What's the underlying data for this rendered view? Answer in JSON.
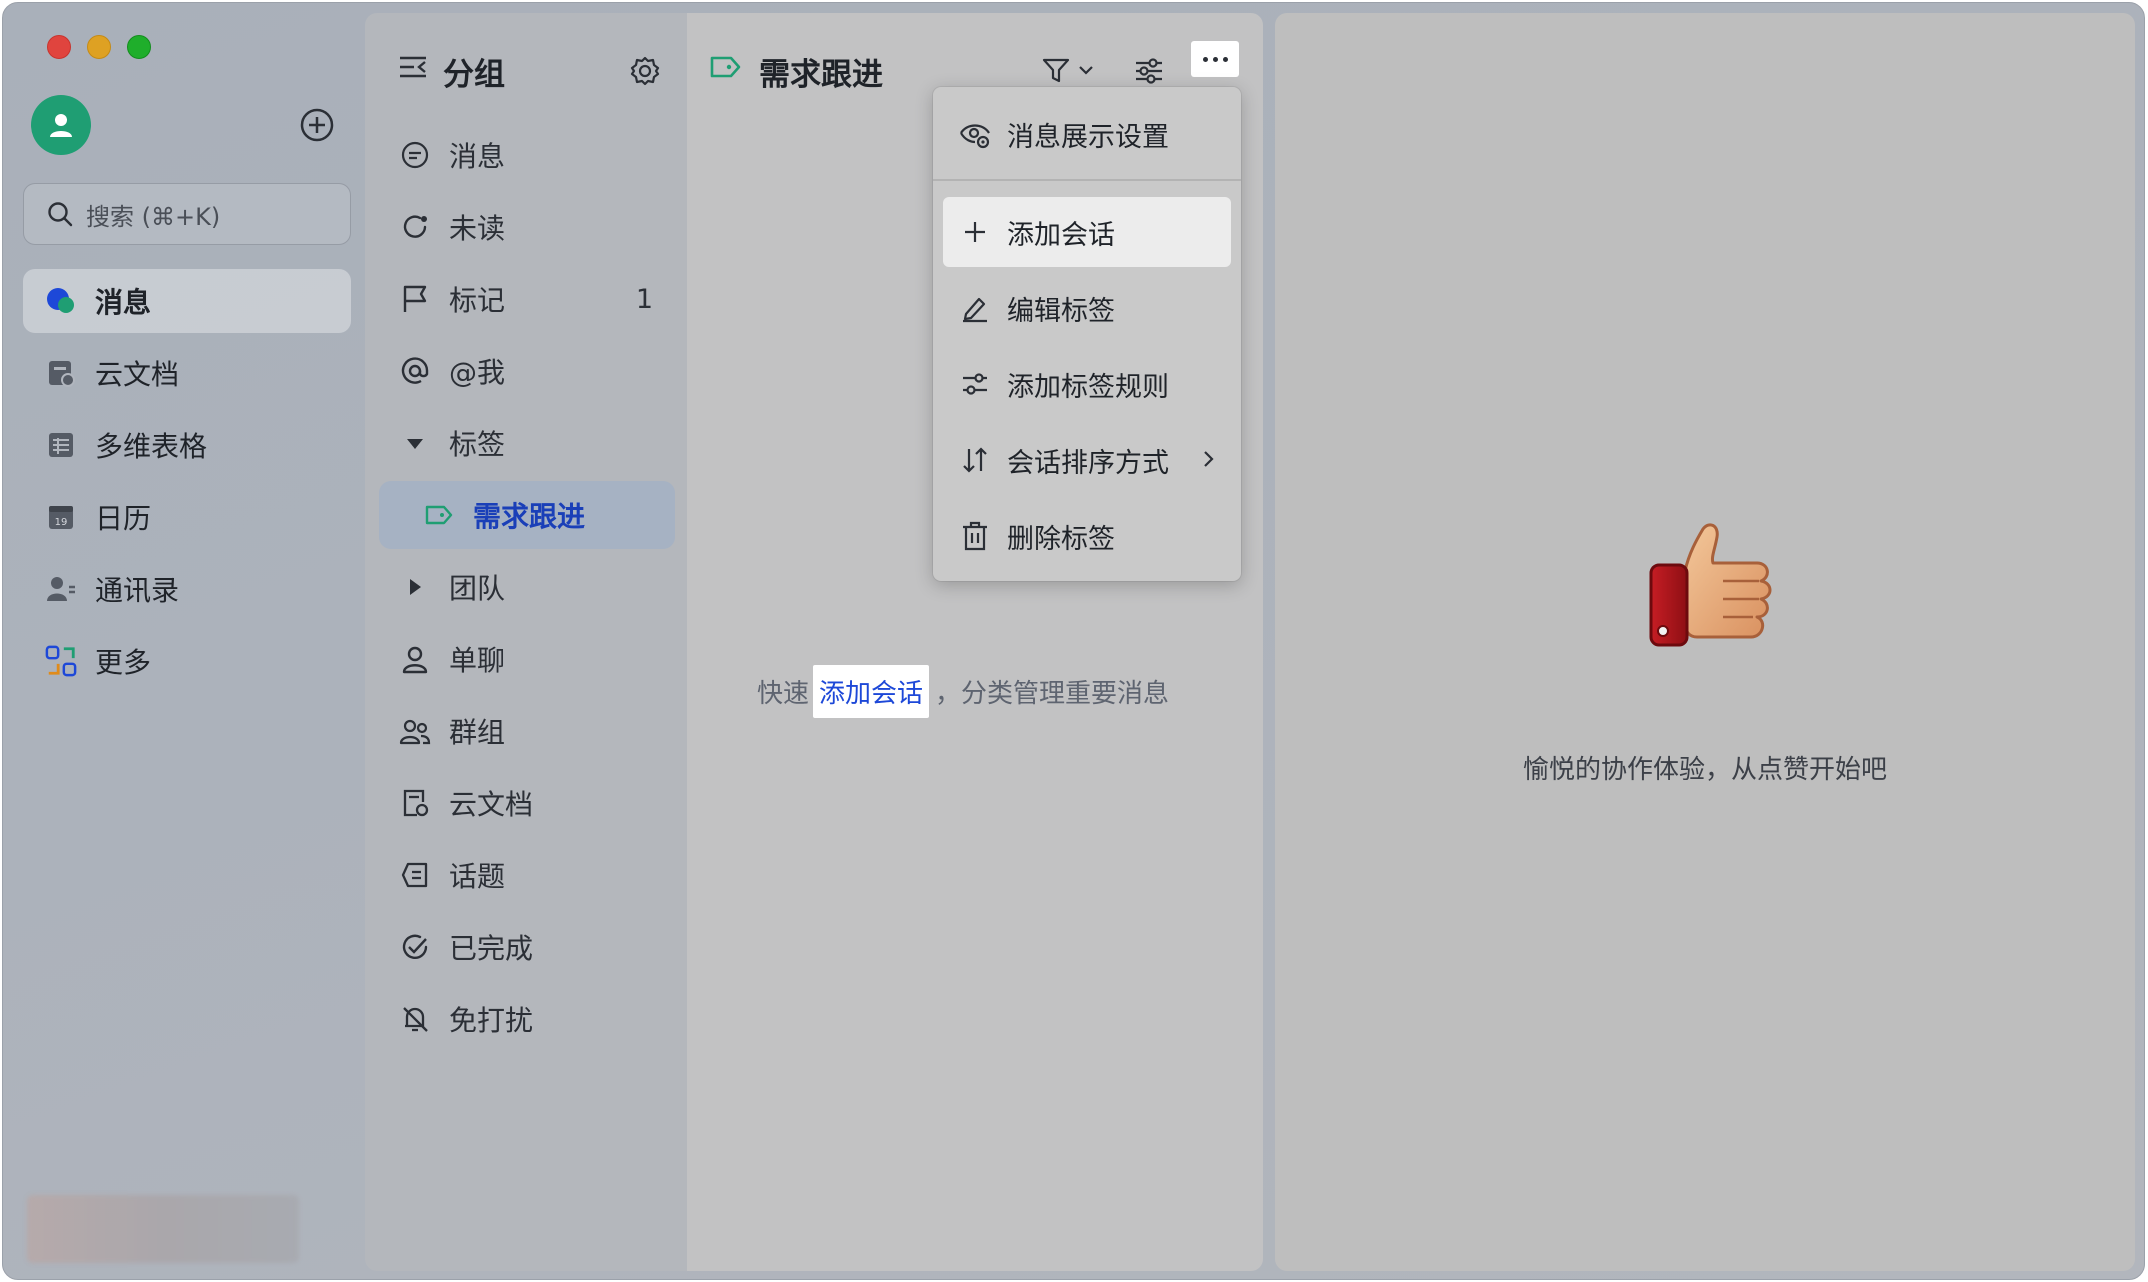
{
  "window": {
    "traffic_lights": [
      "close",
      "minimize",
      "maximize"
    ]
  },
  "sidebar": {
    "search_placeholder": "搜索 (⌘+K)",
    "items": [
      {
        "label": "消息",
        "icon": "message-bubble-icon",
        "active": true
      },
      {
        "label": "云文档",
        "icon": "cloud-doc-icon"
      },
      {
        "label": "多维表格",
        "icon": "table-icon"
      },
      {
        "label": "日历",
        "icon": "calendar-icon",
        "badge": "19"
      },
      {
        "label": "通讯录",
        "icon": "contacts-icon"
      },
      {
        "label": "更多",
        "icon": "more-apps-icon"
      }
    ]
  },
  "groups": {
    "title": "分组",
    "items": [
      {
        "label": "消息",
        "icon": "chat-icon"
      },
      {
        "label": "未读",
        "icon": "unread-icon"
      },
      {
        "label": "标记",
        "icon": "flag-icon",
        "count": "1"
      },
      {
        "label": "@我",
        "icon": "at-icon"
      },
      {
        "label": "标签",
        "icon": "caret-down-icon"
      },
      {
        "label": "需求跟进",
        "icon": "tag-icon",
        "selected": true
      },
      {
        "label": "团队",
        "icon": "caret-right-icon"
      },
      {
        "label": "单聊",
        "icon": "person-icon"
      },
      {
        "label": "群组",
        "icon": "group-icon"
      },
      {
        "label": "云文档",
        "icon": "doc-icon"
      },
      {
        "label": "话题",
        "icon": "topic-icon"
      },
      {
        "label": "已完成",
        "icon": "done-icon"
      },
      {
        "label": "免打扰",
        "icon": "mute-bell-icon"
      }
    ]
  },
  "list": {
    "title": "需求跟进",
    "empty_prefix": "快速",
    "empty_link": "添加会话",
    "empty_suffix": "，分类管理重要消息"
  },
  "menu": {
    "items": [
      {
        "label": "消息展示设置",
        "icon": "eye-gear-icon"
      },
      {
        "label": "添加会话",
        "icon": "plus-icon",
        "highlighted": true
      },
      {
        "label": "编辑标签",
        "icon": "pencil-icon"
      },
      {
        "label": "添加标签规则",
        "icon": "sliders-icon"
      },
      {
        "label": "会话排序方式",
        "icon": "sort-icon",
        "submenu": true
      },
      {
        "label": "删除标签",
        "icon": "trash-icon"
      }
    ]
  },
  "right": {
    "message": "愉悦的协作体验，从点赞开始吧"
  },
  "colors": {
    "accent_blue": "#1d48d8",
    "tag_green": "#1f9e73",
    "selected_bg": "#a6b2c3"
  }
}
